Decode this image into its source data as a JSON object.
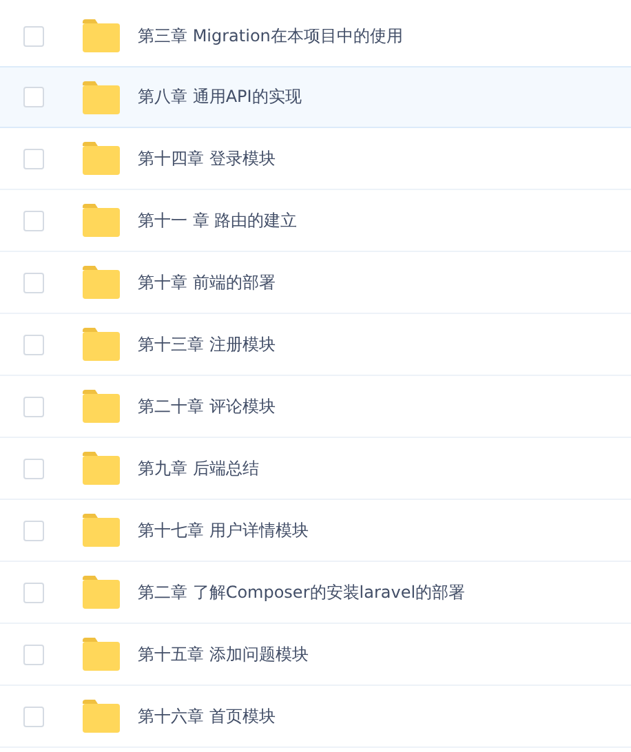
{
  "files": [
    {
      "name": "第三章 Migration在本项目中的使用",
      "checked": false,
      "selected": false
    },
    {
      "name": "第八章 通用API的实现",
      "checked": false,
      "selected": true
    },
    {
      "name": "第十四章 登录模块",
      "checked": false,
      "selected": false
    },
    {
      "name": "第十一 章 路由的建立",
      "checked": false,
      "selected": false
    },
    {
      "name": "第十章 前端的部署",
      "checked": false,
      "selected": false
    },
    {
      "name": "第十三章 注册模块",
      "checked": false,
      "selected": false
    },
    {
      "name": "第二十章 评论模块",
      "checked": false,
      "selected": false
    },
    {
      "name": "第九章 后端总结",
      "checked": false,
      "selected": false
    },
    {
      "name": "第十七章 用户详情模块",
      "checked": false,
      "selected": false
    },
    {
      "name": "第二章 了解Composer的安装laravel的部署",
      "checked": false,
      "selected": false
    },
    {
      "name": "第十五章 添加问题模块",
      "checked": false,
      "selected": false
    },
    {
      "name": "第十六章 首页模块",
      "checked": false,
      "selected": false
    }
  ]
}
